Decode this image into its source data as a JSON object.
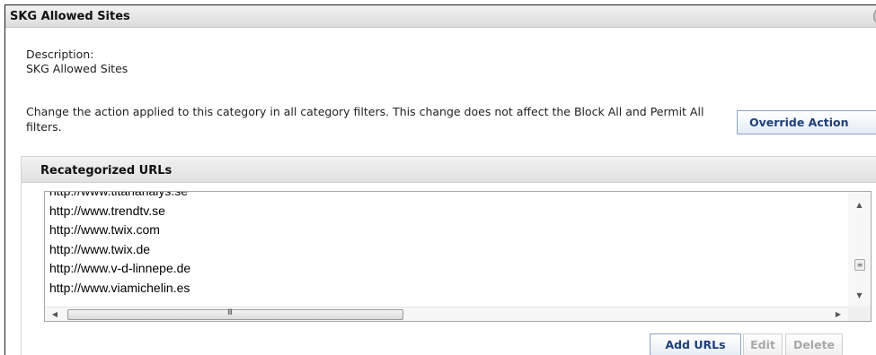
{
  "panel": {
    "title": "SKG Allowed Sites"
  },
  "description": {
    "label": "Description:",
    "value": "SKG Allowed Sites"
  },
  "change_notice": "Change the action applied to this category in all category filters. This change does not affect the Block All and Permit All filters.",
  "override_button_label": "Override Action",
  "recategorized": {
    "title": "Recategorized URLs",
    "urls": [
      "http://www.titananalys.se",
      "http://www.trendtv.se",
      "http://www.twix.com",
      "http://www.twix.de",
      "http://www.v-d-linnepe.de",
      "http://www.viamichelin.es"
    ],
    "buttons": {
      "add_label": "Add URLs",
      "edit_label": "Edit",
      "delete_label": "Delete"
    }
  },
  "scrollbar_glyphs": {
    "up": "▲",
    "down": "▼",
    "left": "◀",
    "right": "▶",
    "thumb_grip": "III",
    "side_grip": "≡"
  },
  "colors": {
    "button_text": "#1e3f78",
    "button_border": "#8aa5c2",
    "disabled_text": "#a9a9a9"
  }
}
